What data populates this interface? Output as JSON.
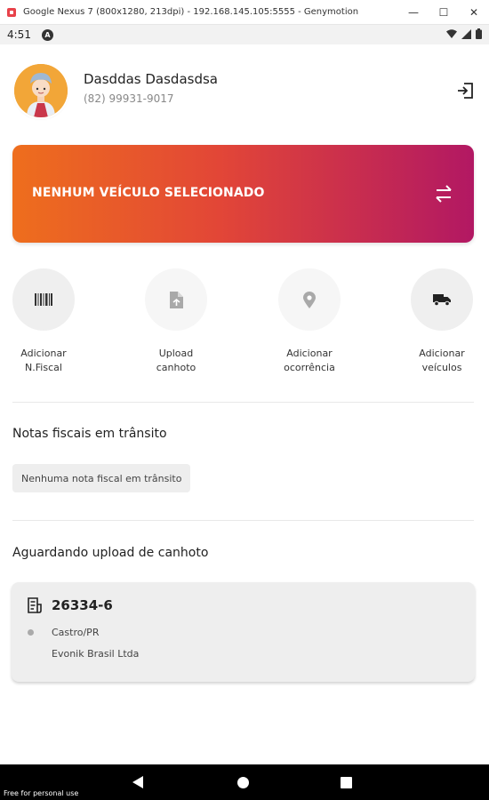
{
  "window": {
    "title": "Google Nexus 7 (800x1280, 213dpi) - 192.168.145.105:5555 - Genymotion",
    "controls": [
      "—",
      "☐",
      "✕"
    ]
  },
  "status_bar": {
    "time": "4:51",
    "icons": [
      "wifi-icon",
      "signal-icon",
      "battery-icon"
    ]
  },
  "profile": {
    "name": "Dasddas Dasdasdsa",
    "phone": "(82) 99931-9017"
  },
  "vehicle_banner": {
    "label": "NENHUM VEÍCULO SELECIONADO",
    "gradient_colors": [
      "#ee6e1d",
      "#e24637",
      "#b21863"
    ]
  },
  "actions": [
    {
      "label": "Adicionar\nN.Fiscal",
      "icon": "barcode-icon"
    },
    {
      "label": "Upload\ncanhoto",
      "icon": "file-upload-icon"
    },
    {
      "label": "Adicionar\nocorrência",
      "icon": "location-pin-icon"
    },
    {
      "label": "Adicionar\nveículos",
      "icon": "truck-icon"
    }
  ],
  "in_transit": {
    "title": "Notas fiscais em trânsito",
    "empty_text": "Nenhuma nota fiscal em trânsito"
  },
  "awaiting_upload": {
    "title": "Aguardando upload de canhoto",
    "items": [
      {
        "number": "26334-6",
        "city": "Castro/PR",
        "company": "Evonik Brasil Ltda"
      }
    ]
  },
  "nav": {
    "watermark": "Free for personal use"
  }
}
